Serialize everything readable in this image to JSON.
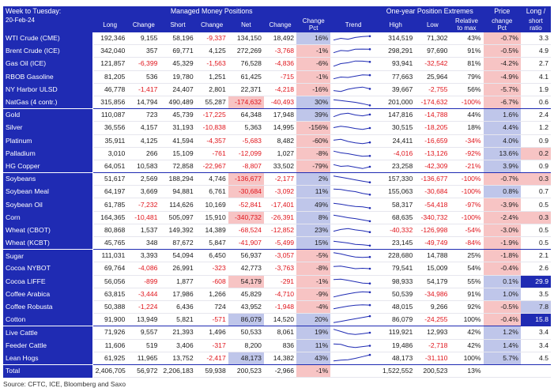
{
  "header": {
    "title_line1": "Week to Tuesday:",
    "title_line2": "20-Feb-24",
    "mm_title": "Managed Money Positions",
    "extremes_title": "One-year Position Extremes",
    "price_title": "Price",
    "price_sub": "change",
    "price_sub2": "Pct",
    "ratio_title": "Long /",
    "ratio_sub": "short",
    "ratio_sub2": "ratio",
    "col_long": "Long",
    "col_change1": "Change",
    "col_short": "Short",
    "col_change2": "Change",
    "col_net": "Net",
    "col_change3": "Change",
    "col_change_pct_1": "Change",
    "col_change_pct_2": "Pct",
    "col_trend": "Trend",
    "col_high": "High",
    "col_low": "Low",
    "col_rel_1": "Relative",
    "col_rel_2": "to max"
  },
  "rows": [
    {
      "name": "WTI Crude (CME)",
      "long": "192,346",
      "chg1": "9,155",
      "short": "58,196",
      "chg2": "-9,337",
      "net": "134,150",
      "chg3": "18,492",
      "pct": "16%",
      "high": "314,519",
      "low": "71,302",
      "rel": "43%",
      "price": "-0.7%",
      "ratio": "3.3",
      "trend": [
        0.3,
        0.5,
        0.4,
        0.6,
        0.7,
        0.75
      ],
      "pctc": "#bfc6ea",
      "pricec": "#f7c4c4",
      "ratioc": "",
      "netc": "",
      "group_end": false
    },
    {
      "name": "Brent Crude (ICE)",
      "long": "342,040",
      "chg1": "357",
      "short": "69,771",
      "chg2": "4,125",
      "net": "272,269",
      "chg3": "-3,768",
      "pct": "-1%",
      "high": "298,291",
      "low": "97,690",
      "rel": "91%",
      "price": "-0.5%",
      "ratio": "4.9",
      "trend": [
        0.3,
        0.55,
        0.5,
        0.7,
        0.72,
        0.7
      ],
      "pctc": "#f7c4c4",
      "pricec": "#f7c4c4",
      "ratioc": "",
      "netc": "",
      "group_end": false
    },
    {
      "name": "Gas Oil (ICE)",
      "long": "121,857",
      "chg1": "-6,399",
      "short": "45,329",
      "chg2": "-1,563",
      "net": "76,528",
      "chg3": "-4,836",
      "pct": "-6%",
      "high": "93,941",
      "low": "-32,542",
      "rel": "81%",
      "price": "-4.2%",
      "ratio": "2.7",
      "trend": [
        0.2,
        0.5,
        0.6,
        0.8,
        0.78,
        0.7
      ],
      "pctc": "#f7c4c4",
      "pricec": "#f7c4c4",
      "ratioc": "",
      "netc": "",
      "group_end": false
    },
    {
      "name": "RBOB Gasoline",
      "long": "81,205",
      "chg1": "536",
      "short": "19,780",
      "chg2": "1,251",
      "net": "61,425",
      "chg3": "-715",
      "pct": "-1%",
      "high": "77,663",
      "low": "25,964",
      "rel": "79%",
      "price": "-4.9%",
      "ratio": "4.1",
      "trend": [
        0.3,
        0.5,
        0.45,
        0.6,
        0.75,
        0.72
      ],
      "pctc": "#f7c4c4",
      "pricec": "#f7c4c4",
      "ratioc": "",
      "netc": "",
      "group_end": false
    },
    {
      "name": "NY Harbor ULSD",
      "long": "46,778",
      "chg1": "-1,417",
      "short": "24,407",
      "chg2": "2,801",
      "net": "22,371",
      "chg3": "-4,218",
      "pct": "-16%",
      "high": "39,667",
      "low": "-2,755",
      "rel": "56%",
      "price": "-5.7%",
      "ratio": "1.9",
      "trend": [
        0.4,
        0.3,
        0.55,
        0.7,
        0.8,
        0.6
      ],
      "pctc": "#f7c4c4",
      "pricec": "#f7c4c4",
      "ratioc": "",
      "netc": "",
      "group_end": false
    },
    {
      "name": "NatGas (4 contr.)",
      "long": "315,856",
      "chg1": "14,794",
      "short": "490,489",
      "chg2": "55,287",
      "net": "-174,632",
      "chg3": "-40,493",
      "pct": "30%",
      "high": "201,000",
      "low": "-174,632",
      "rel": "-100%",
      "price": "-6.7%",
      "ratio": "0.6",
      "trend": [
        0.8,
        0.7,
        0.6,
        0.5,
        0.35,
        0.15
      ],
      "pctc": "#bfc6ea",
      "pricec": "#f7c4c4",
      "ratioc": "",
      "netc": "#f7c4c4",
      "group_end": true
    },
    {
      "name": "Gold",
      "long": "110,087",
      "chg1": "723",
      "short": "45,739",
      "chg2": "-17,225",
      "net": "64,348",
      "chg3": "17,948",
      "pct": "39%",
      "high": "147,816",
      "low": "-14,788",
      "rel": "44%",
      "price": "1.6%",
      "ratio": "2.4",
      "trend": [
        0.3,
        0.6,
        0.7,
        0.5,
        0.4,
        0.55
      ],
      "pctc": "#bfc6ea",
      "pricec": "#bfc6ea",
      "ratioc": "",
      "netc": "",
      "group_end": false
    },
    {
      "name": "Silver",
      "long": "36,556",
      "chg1": "4,157",
      "short": "31,193",
      "chg2": "-10,838",
      "net": "5,363",
      "chg3": "14,995",
      "pct": "-156%",
      "high": "30,515",
      "low": "-18,205",
      "rel": "18%",
      "price": "4.4%",
      "ratio": "1.2",
      "trend": [
        0.5,
        0.65,
        0.55,
        0.4,
        0.3,
        0.45
      ],
      "pctc": "#f7c4c4",
      "pricec": "#bfc6ea",
      "ratioc": "",
      "netc": "",
      "group_end": false
    },
    {
      "name": "Platinum",
      "long": "35,911",
      "chg1": "4,125",
      "short": "41,594",
      "chg2": "-4,357",
      "net": "-5,683",
      "chg3": "8,482",
      "pct": "-60%",
      "high": "24,411",
      "low": "-16,659",
      "rel": "-34%",
      "price": "4.0%",
      "ratio": "0.9",
      "trend": [
        0.6,
        0.7,
        0.45,
        0.3,
        0.2,
        0.35
      ],
      "pctc": "#f7c4c4",
      "pricec": "#bfc6ea",
      "ratioc": "",
      "netc": "",
      "group_end": false
    },
    {
      "name": "Palladium",
      "long": "3,010",
      "chg1": "266",
      "short": "15,109",
      "chg2": "-761",
      "net": "-12,099",
      "chg3": "1,027",
      "pct": "-8%",
      "high": "-4,016",
      "low": "-13,126",
      "rel": "-92%",
      "price": "13.6%",
      "ratio": "0.2",
      "trend": [
        0.8,
        0.6,
        0.5,
        0.35,
        0.2,
        0.25
      ],
      "pctc": "#f7c4c4",
      "pricec": "#bfc6ea",
      "ratioc": "#f7c4c4",
      "netc": "",
      "group_end": false
    },
    {
      "name": "HG Copper",
      "long": "64,051",
      "chg1": "10,583",
      "short": "72,858",
      "chg2": "-22,967",
      "net": "-8,807",
      "chg3": "33,502",
      "pct": "-79%",
      "high": "23,258",
      "low": "-42,309",
      "rel": "-21%",
      "price": "3.9%",
      "ratio": "0.9",
      "trend": [
        0.7,
        0.5,
        0.55,
        0.4,
        0.25,
        0.45
      ],
      "pctc": "#f7c4c4",
      "pricec": "#bfc6ea",
      "ratioc": "",
      "netc": "",
      "group_end": true
    },
    {
      "name": "Soybeans",
      "long": "51,617",
      "chg1": "2,569",
      "short": "188,294",
      "chg2": "4,746",
      "net": "-136,677",
      "chg3": "-2,177",
      "pct": "2%",
      "high": "157,330",
      "low": "-136,677",
      "rel": "-100%",
      "price": "-0.7%",
      "ratio": "0.3",
      "trend": [
        0.85,
        0.7,
        0.55,
        0.4,
        0.25,
        0.12
      ],
      "pctc": "#bfc6ea",
      "pricec": "#f7c4c4",
      "ratioc": "#f7c4c4",
      "netc": "#f7c4c4",
      "group_end": false
    },
    {
      "name": "Soybean Meal",
      "long": "64,197",
      "chg1": "3,669",
      "short": "94,881",
      "chg2": "6,761",
      "net": "-30,684",
      "chg3": "-3,092",
      "pct": "11%",
      "high": "155,063",
      "low": "-30,684",
      "rel": "-100%",
      "price": "0.8%",
      "ratio": "0.7",
      "trend": [
        0.8,
        0.75,
        0.6,
        0.5,
        0.3,
        0.15
      ],
      "pctc": "#bfc6ea",
      "pricec": "#bfc6ea",
      "ratioc": "",
      "netc": "#f7c4c4",
      "group_end": false
    },
    {
      "name": "Soybean Oil",
      "long": "61,785",
      "chg1": "-7,232",
      "short": "114,626",
      "chg2": "10,169",
      "net": "-52,841",
      "chg3": "-17,401",
      "pct": "49%",
      "high": "58,317",
      "low": "-54,418",
      "rel": "-97%",
      "price": "-3.9%",
      "ratio": "0.5",
      "trend": [
        0.7,
        0.6,
        0.45,
        0.35,
        0.3,
        0.15
      ],
      "pctc": "#bfc6ea",
      "pricec": "#f7c4c4",
      "ratioc": "",
      "netc": "",
      "group_end": false
    },
    {
      "name": "Corn",
      "long": "164,365",
      "chg1": "-10,481",
      "short": "505,097",
      "chg2": "15,910",
      "net": "-340,732",
      "chg3": "-26,391",
      "pct": "8%",
      "high": "68,635",
      "low": "-340,732",
      "rel": "-100%",
      "price": "-2.4%",
      "ratio": "0.3",
      "trend": [
        0.8,
        0.65,
        0.5,
        0.4,
        0.25,
        0.1
      ],
      "pctc": "#bfc6ea",
      "pricec": "#f7c4c4",
      "ratioc": "#f7c4c4",
      "netc": "#f7c4c4",
      "group_end": false
    },
    {
      "name": "Wheat (CBOT)",
      "long": "80,868",
      "chg1": "1,537",
      "short": "149,392",
      "chg2": "14,389",
      "net": "-68,524",
      "chg3": "-12,852",
      "pct": "23%",
      "high": "-40,332",
      "low": "-126,998",
      "rel": "-54%",
      "price": "-3.0%",
      "ratio": "0.5",
      "trend": [
        0.4,
        0.6,
        0.7,
        0.55,
        0.45,
        0.3
      ],
      "pctc": "#bfc6ea",
      "pricec": "#f7c4c4",
      "ratioc": "",
      "netc": "",
      "group_end": false
    },
    {
      "name": "Wheat (KCBT)",
      "long": "45,765",
      "chg1": "348",
      "short": "87,672",
      "chg2": "5,847",
      "net": "-41,907",
      "chg3": "-5,499",
      "pct": "15%",
      "high": "23,145",
      "low": "-49,749",
      "rel": "-84%",
      "price": "-1.9%",
      "ratio": "0.5",
      "trend": [
        0.7,
        0.6,
        0.5,
        0.35,
        0.3,
        0.2
      ],
      "pctc": "#bfc6ea",
      "pricec": "#f7c4c4",
      "ratioc": "",
      "netc": "",
      "group_end": true
    },
    {
      "name": "Sugar",
      "long": "111,031",
      "chg1": "3,393",
      "short": "54,094",
      "chg2": "6,450",
      "net": "56,937",
      "chg3": "-3,057",
      "pct": "-5%",
      "high": "228,680",
      "low": "14,788",
      "rel": "25%",
      "price": "-1.8%",
      "ratio": "2.1",
      "trend": [
        0.85,
        0.7,
        0.5,
        0.35,
        0.3,
        0.35
      ],
      "pctc": "#f7c4c4",
      "pricec": "#f7c4c4",
      "ratioc": "",
      "netc": "",
      "group_end": false
    },
    {
      "name": "Cocoa NYBOT",
      "long": "69,764",
      "chg1": "-4,086",
      "short": "26,991",
      "chg2": "-323",
      "net": "42,773",
      "chg3": "-3,763",
      "pct": "-8%",
      "high": "79,541",
      "low": "15,009",
      "rel": "54%",
      "price": "-0.4%",
      "ratio": "2.6",
      "trend": [
        0.7,
        0.75,
        0.6,
        0.45,
        0.5,
        0.45
      ],
      "pctc": "#f7c4c4",
      "pricec": "#f7c4c4",
      "ratioc": "",
      "netc": "",
      "group_end": false
    },
    {
      "name": "Cocoa LIFFE",
      "long": "56,056",
      "chg1": "-899",
      "short": "1,877",
      "chg2": "-608",
      "net": "54,179",
      "chg3": "-291",
      "pct": "-1%",
      "high": "98,933",
      "low": "54,179",
      "rel": "55%",
      "price": "0.1%",
      "ratio": "29.9",
      "trend": [
        0.75,
        0.8,
        0.65,
        0.5,
        0.35,
        0.3
      ],
      "pctc": "#f7c4c4",
      "pricec": "#bfc6ea",
      "ratioc": "#1f2bb3",
      "netc": "#f7c4c4",
      "group_end": false
    },
    {
      "name": "Coffee Arabica",
      "long": "63,815",
      "chg1": "-3,444",
      "short": "17,986",
      "chg2": "1,266",
      "net": "45,829",
      "chg3": "-4,710",
      "pct": "-9%",
      "high": "50,539",
      "low": "-34,986",
      "rel": "91%",
      "price": "1.0%",
      "ratio": "3.5",
      "trend": [
        0.2,
        0.4,
        0.55,
        0.7,
        0.8,
        0.75
      ],
      "pctc": "#f7c4c4",
      "pricec": "#bfc6ea",
      "ratioc": "",
      "netc": "",
      "group_end": false
    },
    {
      "name": "Coffee Robusta",
      "long": "50,388",
      "chg1": "-1,224",
      "short": "6,436",
      "chg2": "724",
      "net": "43,952",
      "chg3": "-1,948",
      "pct": "-4%",
      "high": "48,015",
      "low": "9,266",
      "rel": "92%",
      "price": "-0.5%",
      "ratio": "7.8",
      "trend": [
        0.3,
        0.45,
        0.6,
        0.7,
        0.75,
        0.72
      ],
      "pctc": "#f7c4c4",
      "pricec": "#f7c4c4",
      "ratioc": "#bfc6ea",
      "netc": "",
      "group_end": false
    },
    {
      "name": "Cotton",
      "long": "91,900",
      "chg1": "13,949",
      "short": "5,821",
      "chg2": "-571",
      "net": "86,079",
      "chg3": "14,520",
      "pct": "20%",
      "high": "86,079",
      "low": "-24,255",
      "rel": "100%",
      "price": "-0.4%",
      "ratio": "15.8",
      "trend": [
        0.15,
        0.3,
        0.45,
        0.6,
        0.75,
        0.9
      ],
      "pctc": "#bfc6ea",
      "pricec": "#f7c4c4",
      "ratioc": "#1f2bb3",
      "netc": "#bfc6ea",
      "group_end": true
    },
    {
      "name": "Live Cattle",
      "long": "71,926",
      "chg1": "9,557",
      "short": "21,393",
      "chg2": "1,496",
      "net": "50,533",
      "chg3": "8,061",
      "pct": "19%",
      "high": "119,921",
      "low": "12,993",
      "rel": "42%",
      "price": "1.2%",
      "ratio": "3.4",
      "trend": [
        0.85,
        0.6,
        0.35,
        0.25,
        0.35,
        0.45
      ],
      "pctc": "#bfc6ea",
      "pricec": "#bfc6ea",
      "ratioc": "",
      "netc": "",
      "group_end": false
    },
    {
      "name": "Feeder Cattle",
      "long": "11,606",
      "chg1": "519",
      "short": "3,406",
      "chg2": "-317",
      "net": "8,200",
      "chg3": "836",
      "pct": "11%",
      "high": "19,486",
      "low": "-2,718",
      "rel": "42%",
      "price": "1.4%",
      "ratio": "3.4",
      "trend": [
        0.7,
        0.65,
        0.4,
        0.3,
        0.4,
        0.5
      ],
      "pctc": "#bfc6ea",
      "pricec": "#bfc6ea",
      "ratioc": "",
      "netc": "",
      "group_end": false
    },
    {
      "name": "Lean Hogs",
      "long": "61,925",
      "chg1": "11,965",
      "short": "13,752",
      "chg2": "-2,417",
      "net": "48,173",
      "chg3": "14,382",
      "pct": "43%",
      "high": "48,173",
      "low": "-31,110",
      "rel": "100%",
      "price": "5.7%",
      "ratio": "4.5",
      "trend": [
        0.2,
        0.3,
        0.35,
        0.5,
        0.7,
        0.9
      ],
      "pctc": "#bfc6ea",
      "pricec": "#bfc6ea",
      "ratioc": "",
      "netc": "#bfc6ea",
      "group_end": true
    }
  ],
  "total": {
    "name": "Total",
    "long": "2,406,705",
    "chg1": "56,972",
    "short": "2,206,183",
    "chg2": "59,938",
    "net": "200,523",
    "chg3": "-2,966",
    "pct": "-1%",
    "high": "1,522,552",
    "low": "200,523",
    "rel": "13%"
  },
  "source": "Source: CFTC, ICE, Bloomberg and Saxo",
  "colors": {
    "brand": "#1f2bb3",
    "negative": "#e0151c",
    "neg_fill": "#f7c4c4",
    "pos_fill": "#bfc6ea"
  }
}
